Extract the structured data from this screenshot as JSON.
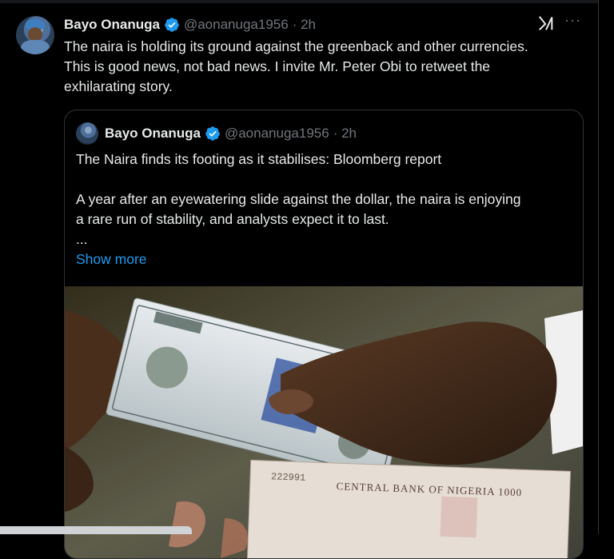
{
  "tweet": {
    "author_name": "Bayo Onanuga",
    "handle": "@aonanuga1956",
    "time": "· 2h",
    "text_lines": [
      "The naira is holding its ground against the greenback and other currencies.",
      "This is good news, not bad news. I invite Mr. Peter Obi to retweet the",
      "exhilarating story."
    ],
    "more_icon": "···"
  },
  "quote": {
    "author_name": "Bayo Onanuga",
    "handle": "@aonanuga1956",
    "time": "· 2h",
    "title": "The Naira finds its footing as it stabilises: Bloomberg report",
    "body_lines": [
      "A year after an eyewatering slide against the dollar, the naira is enjoying",
      "a rare run of stability, and analysts expect it to last.",
      "..."
    ],
    "show_more": "Show more",
    "image": {
      "note_serial": "222991",
      "note_text": "CENTRAL BANK OF NIGERIA 1000"
    }
  },
  "colors": {
    "background": "#000000",
    "text": "#e7e9ea",
    "muted": "#71767b",
    "link": "#1d9bf0",
    "verified": "#1d9bf0",
    "border": "#2f3336"
  }
}
